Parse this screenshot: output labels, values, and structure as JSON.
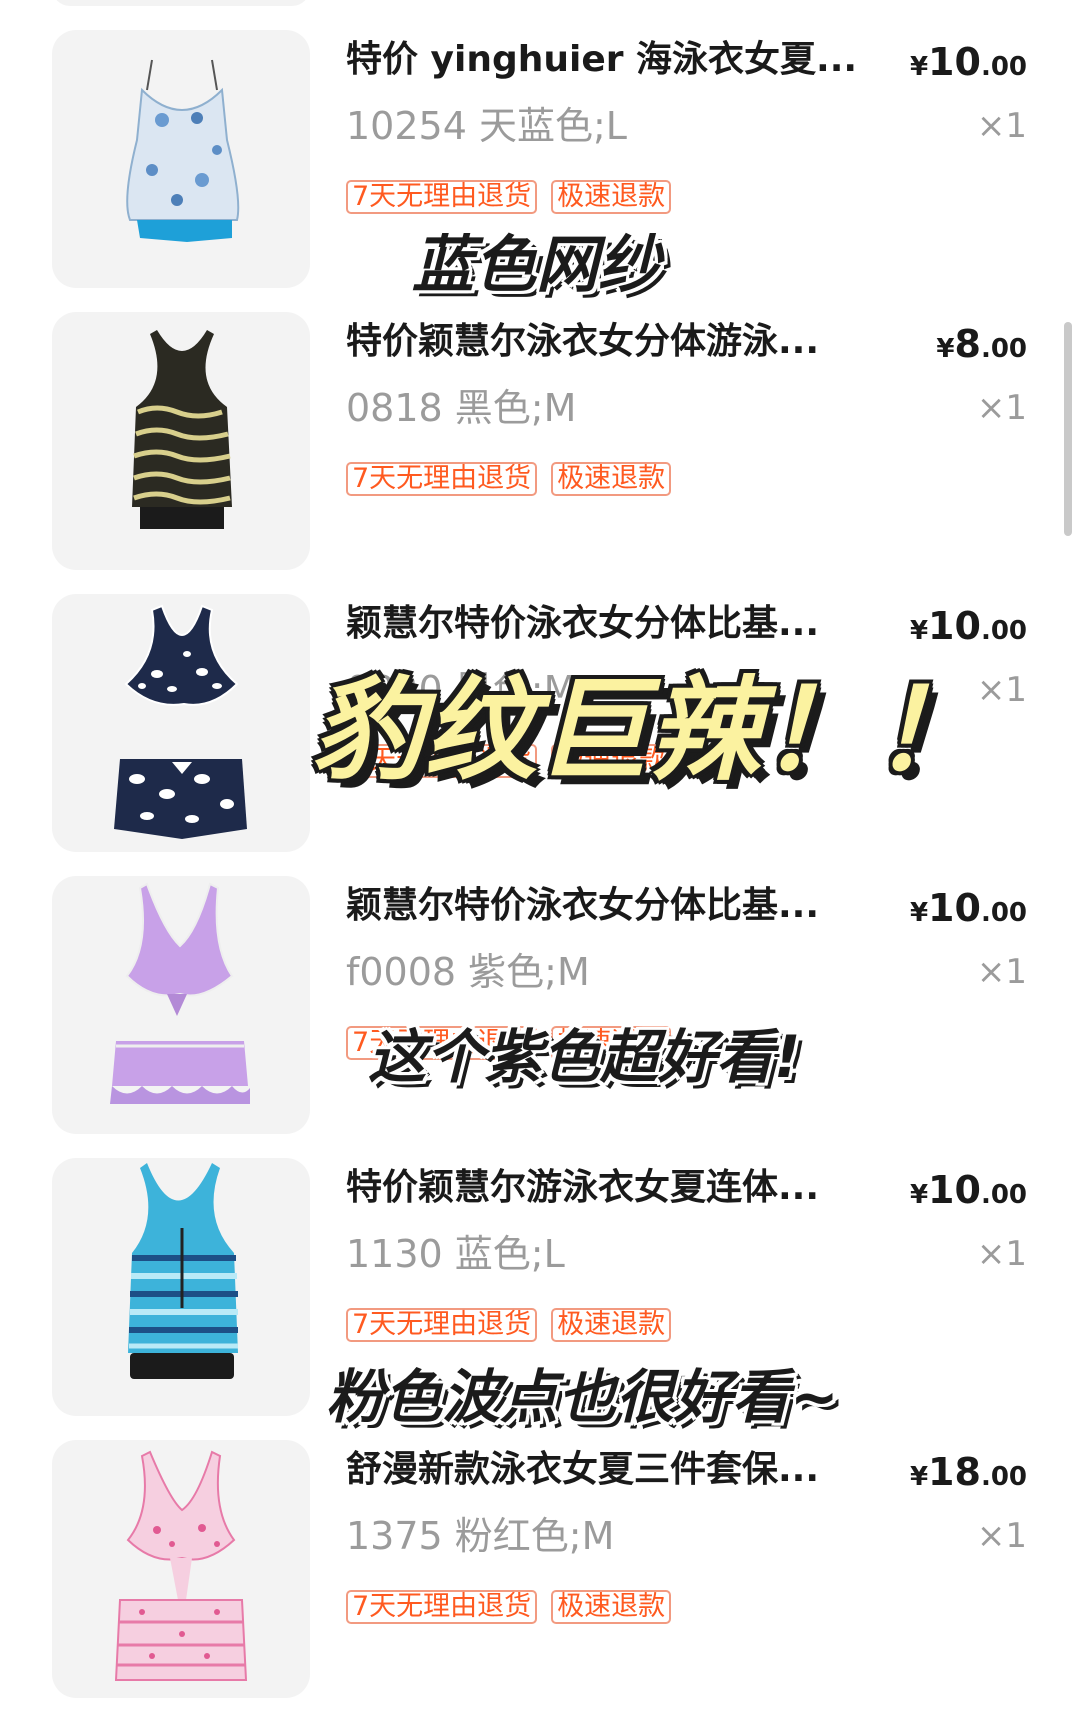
{
  "order_items": [
    {
      "title": "特价 yinghuier 海泳衣女夏...",
      "sku": "10254 天蓝色;L",
      "currency": "¥",
      "price_int": "10",
      "price_dec": ".00",
      "qty": "×1",
      "tags": [
        "7天无理由退货",
        "极速退款"
      ],
      "image": "blue-chiffon-tankini"
    },
    {
      "title": "特价颖慧尔泳衣女分体游泳...",
      "sku": "0818 黑色;M",
      "currency": "¥",
      "price_int": "8",
      "price_dec": ".00",
      "qty": "×1",
      "tags": [
        "7天无理由退货",
        "极速退款"
      ],
      "image": "black-wave-tankini"
    },
    {
      "title": "颖慧尔特价泳衣女分体比基...",
      "sku": "0820 黑色;M",
      "currency": "¥",
      "price_int": "10",
      "price_dec": ".00",
      "qty": "×1",
      "tags": [
        "7天无理由退货",
        "极速退款"
      ],
      "image": "leopard-bikini"
    },
    {
      "title": "颖慧尔特价泳衣女分体比基...",
      "sku": "f0008 紫色;M",
      "currency": "¥",
      "price_int": "10",
      "price_dec": ".00",
      "qty": "×1",
      "tags": [
        "7天无理由退货",
        "极速退款"
      ],
      "image": "purple-ruffle-bikini"
    },
    {
      "title": "特价颖慧尔游泳衣女夏连体...",
      "sku": "1130 蓝色;L",
      "currency": "¥",
      "price_int": "10",
      "price_dec": ".00",
      "qty": "×1",
      "tags": [
        "7天无理由退货",
        "极速退款"
      ],
      "image": "blue-stripe-tankini"
    },
    {
      "title": "舒漫新款泳衣女夏三件套保...",
      "sku": "1375 粉红色;M",
      "currency": "¥",
      "price_int": "18",
      "price_dec": ".00",
      "qty": "×1",
      "tags": [
        "7天无理由退货",
        "极速退款"
      ],
      "image": "pink-polka-bikini"
    }
  ],
  "captions": {
    "blue_mesh": "蓝色网纱",
    "leopard": "豹纹巨辣！！",
    "purple": "这个紫色超好看!",
    "pink": "粉色波点也很好看~"
  },
  "colors": {
    "tag_text": "#ff5a20",
    "tag_border": "#f29a80",
    "muted_text": "#9b9b9b",
    "caption_yellow": "#fbf2a0"
  }
}
